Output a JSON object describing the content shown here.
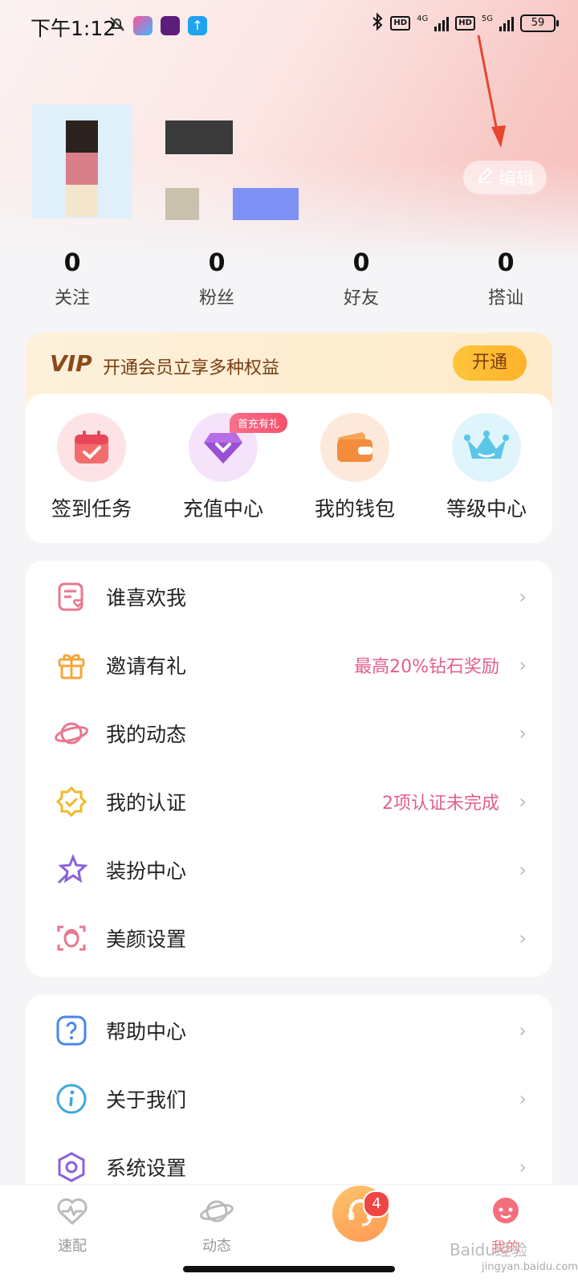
{
  "status_bar": {
    "time": "下午1:12",
    "net1": "4G",
    "net2": "5G",
    "hd": "HD",
    "battery": "59"
  },
  "profile": {
    "edit_label": "编辑"
  },
  "stats": [
    {
      "value": "0",
      "label": "关注"
    },
    {
      "value": "0",
      "label": "粉丝"
    },
    {
      "value": "0",
      "label": "好友"
    },
    {
      "value": "0",
      "label": "搭讪"
    }
  ],
  "vip": {
    "badge": "VIP",
    "text": "开通会员立享多种权益",
    "button": "开通"
  },
  "shortcuts": [
    {
      "label": "签到任务",
      "icon": "calendar-check-icon"
    },
    {
      "label": "充值中心",
      "icon": "diamond-icon",
      "tag": "首充有礼"
    },
    {
      "label": "我的钱包",
      "icon": "wallet-icon"
    },
    {
      "label": "等级中心",
      "icon": "crown-icon"
    }
  ],
  "menu1": [
    {
      "label": "谁喜欢我",
      "hint": "",
      "icon": "heart-card-icon"
    },
    {
      "label": "邀请有礼",
      "hint": "最高20%钻石奖励",
      "icon": "gift-icon"
    },
    {
      "label": "我的动态",
      "hint": "",
      "icon": "planet-icon"
    },
    {
      "label": "我的认证",
      "hint": "2项认证未完成",
      "icon": "verified-badge-icon"
    },
    {
      "label": "装扮中心",
      "hint": "",
      "icon": "star-wand-icon"
    },
    {
      "label": "美颜设置",
      "hint": "",
      "icon": "face-scan-icon"
    }
  ],
  "menu2": [
    {
      "label": "帮助中心",
      "icon": "question-icon"
    },
    {
      "label": "关于我们",
      "icon": "info-icon"
    },
    {
      "label": "系统设置",
      "icon": "settings-gear-icon"
    }
  ],
  "tabbar": {
    "tab1": "速配",
    "tab2": "动态",
    "tab4": "我的",
    "badge": "4"
  },
  "watermark": {
    "brand": "Baidu经验",
    "url": "jingyan.baidu.com"
  }
}
